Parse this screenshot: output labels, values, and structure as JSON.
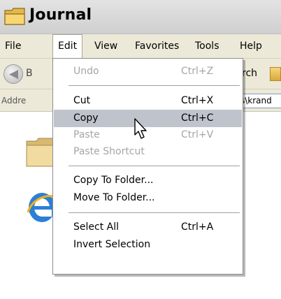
{
  "window": {
    "title": "Journal"
  },
  "menubar": {
    "items": [
      "File",
      "Edit",
      "View",
      "Favorites",
      "Tools",
      "Help"
    ],
    "open_menu": "Edit"
  },
  "toolbar": {
    "back_label": "B",
    "search_label": "rch"
  },
  "addressbar": {
    "label": "Addre",
    "value": "s\\krand"
  },
  "edit_menu": {
    "items": [
      {
        "label": "Undo",
        "shortcut": "Ctrl+Z",
        "enabled": false
      },
      {
        "label": "Cut",
        "shortcut": "Ctrl+X",
        "enabled": true
      },
      {
        "label": "Copy",
        "shortcut": "Ctrl+C",
        "enabled": true,
        "selected": true
      },
      {
        "label": "Paste",
        "shortcut": "Ctrl+V",
        "enabled": false
      },
      {
        "label": "Paste Shortcut",
        "shortcut": "",
        "enabled": false
      },
      {
        "label": "Copy To Folder...",
        "shortcut": "",
        "enabled": true
      },
      {
        "label": "Move To Folder...",
        "shortcut": "",
        "enabled": true
      },
      {
        "label": "Select All",
        "shortcut": "Ctrl+A",
        "enabled": true
      },
      {
        "label": "Invert Selection",
        "shortcut": "",
        "enabled": true
      }
    ]
  },
  "colors": {
    "menubar_bg": "#ece9d8",
    "selected_bg": "#bfc4cc",
    "disabled_text": "#a5a5a5"
  }
}
